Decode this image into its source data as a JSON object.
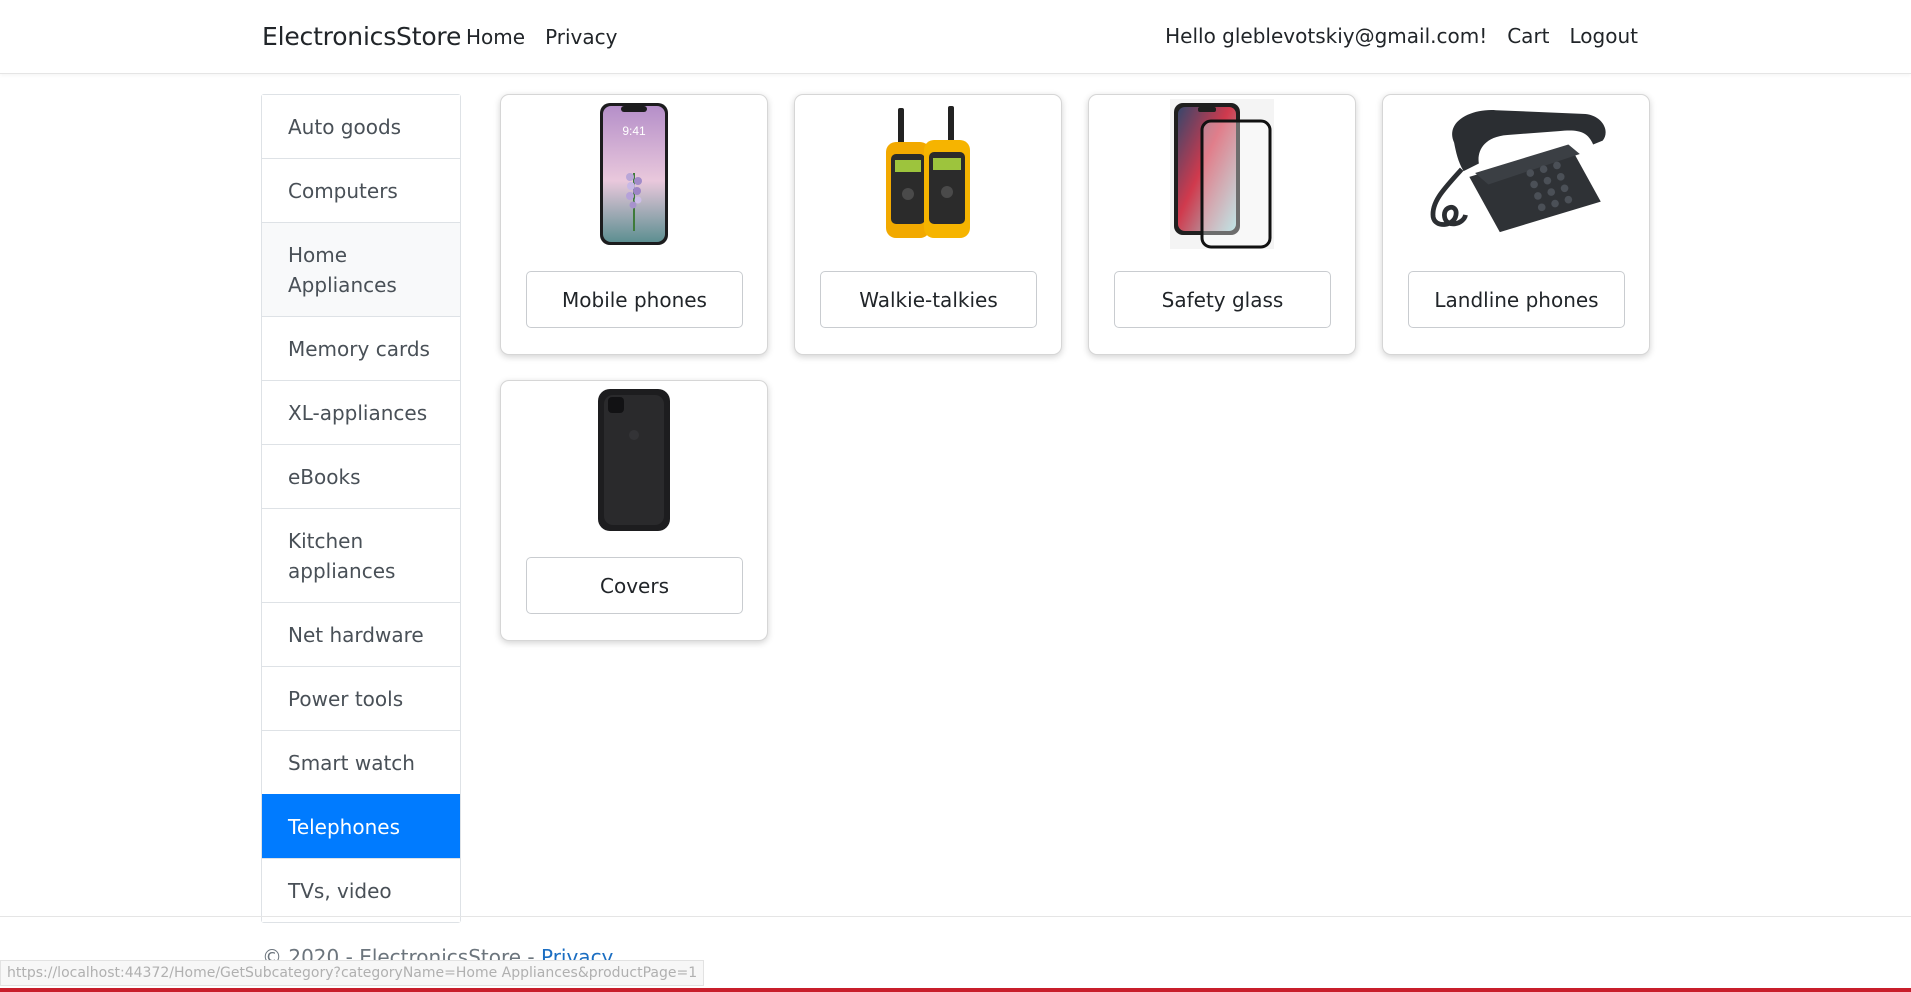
{
  "navbar": {
    "brand": "ElectronicsStore",
    "links": [
      "Home",
      "Privacy"
    ],
    "greeting": "Hello gleblevotskiy@gmail.com!",
    "cart": "Cart",
    "logout": "Logout"
  },
  "sidebar": {
    "items": [
      {
        "label": "Auto goods"
      },
      {
        "label": "Computers"
      },
      {
        "label": "Home Appliances"
      },
      {
        "label": "Memory cards"
      },
      {
        "label": "XL-appliances"
      },
      {
        "label": "eBooks"
      },
      {
        "label": "Kitchen appliances"
      },
      {
        "label": "Net hardware"
      },
      {
        "label": "Power tools"
      },
      {
        "label": "Smart watch"
      },
      {
        "label": "Telephones"
      },
      {
        "label": "TVs, video"
      }
    ],
    "active_item": "Telephones",
    "hovered_item": "Home Appliances"
  },
  "categories": [
    {
      "label": "Mobile phones",
      "icon": "smartphone-image"
    },
    {
      "label": "Walkie-talkies",
      "icon": "walkie-talkie-image"
    },
    {
      "label": "Safety glass",
      "icon": "screen-protector-image"
    },
    {
      "label": "Landline phones",
      "icon": "desk-phone-image"
    },
    {
      "label": "Covers",
      "icon": "phone-case-image"
    }
  ],
  "footer": {
    "copyright": "© 2020 - ElectronicsStore - ",
    "privacy": "Privacy"
  },
  "status_bar": {
    "url": "https://localhost:44372/Home/GetSubcategory?categoryName=Home Appliances&productPage=1"
  },
  "colors": {
    "active": "#007bff",
    "link": "#1b6ec2",
    "bottom_bar": "#c81e2b"
  }
}
